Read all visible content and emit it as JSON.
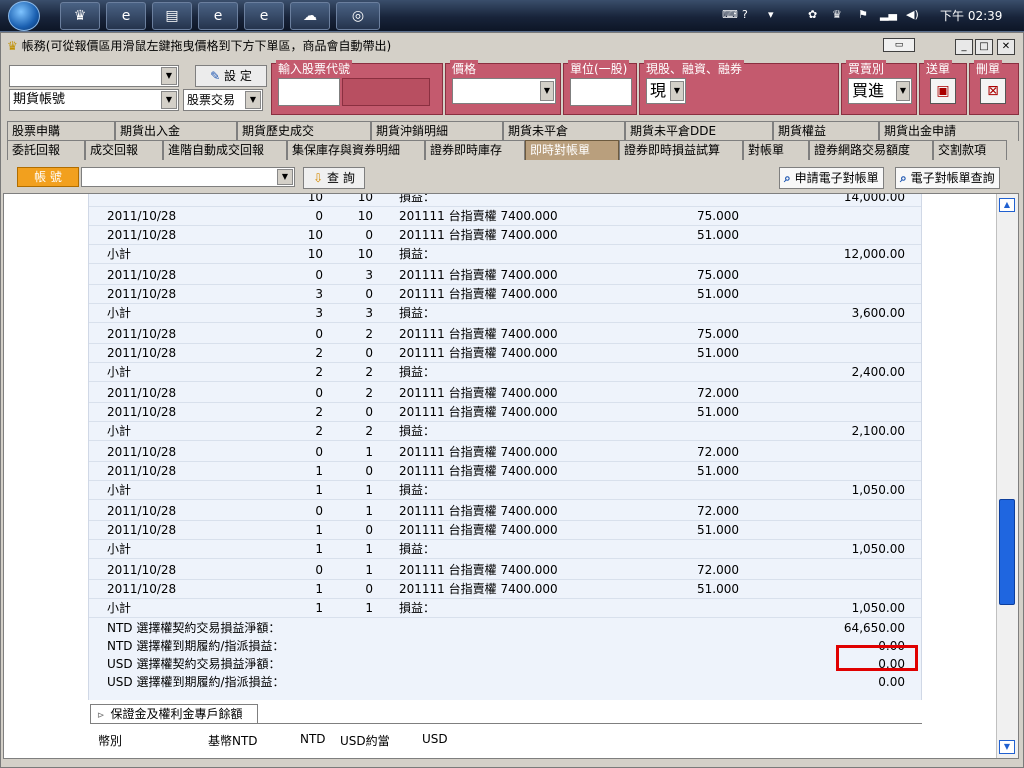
{
  "taskbar": {
    "clock": "下午 02:39"
  },
  "window": {
    "title": "帳務(可從報價區用滑鼠左鍵拖曳價格到下方下單區，商品會自動帶出)",
    "pin_label": "▭"
  },
  "order": {
    "account_value": "",
    "account_type": "期貨帳號",
    "set_label": "設 定",
    "trade_type": "股票交易",
    "groups": {
      "stock_code": "輸入股票代號",
      "price": "價格",
      "unit": "單位(一股)",
      "cash": "現股、融資、融券",
      "side": "買賣別",
      "send": "送單",
      "delete": "刪單"
    },
    "cash_value": "現",
    "side_value": "買進"
  },
  "tabs_row1": [
    "股票申購",
    "期貨出入金",
    "期貨歷史成交",
    "期貨沖銷明細",
    "期貨未平倉",
    "期貨未平倉DDE",
    "期貨權益",
    "期貨出金申請"
  ],
  "tabs_row2": [
    "委託回報",
    "成交回報",
    "進階自動成交回報",
    "集保庫存與資券明細",
    "證券即時庫存",
    "即時對帳單",
    "證券即時損益試算",
    "對帳單",
    "證券網路交易額度",
    "交割款項"
  ],
  "active_tab": "即時對帳單",
  "account_bar": {
    "label": "帳 號",
    "query_label": "查 詢",
    "apply_label": "申請電子對帳單",
    "lookup_label": "電子對帳單查詢"
  },
  "ledger": {
    "top_subtotal_q1": "10",
    "top_subtotal_q2": "10",
    "top_label": "損益：",
    "top_amount": "14,000.00",
    "groups": [
      {
        "buy": {
          "date": "2011/10/28",
          "q1": "0",
          "q2": "10",
          "product": "201111 台指賣權 7400.000",
          "price": "75.000"
        },
        "sell": {
          "date": "2011/10/28",
          "q1": "10",
          "q2": "0",
          "product": "201111 台指賣權 7400.000",
          "price": "51.000"
        },
        "subtotal": {
          "label": "小計",
          "q1": "10",
          "q2": "10",
          "pl": "損益：",
          "amount": "12,000.00"
        }
      },
      {
        "buy": {
          "date": "2011/10/28",
          "q1": "0",
          "q2": "3",
          "product": "201111 台指賣權 7400.000",
          "price": "75.000"
        },
        "sell": {
          "date": "2011/10/28",
          "q1": "3",
          "q2": "0",
          "product": "201111 台指賣權 7400.000",
          "price": "51.000"
        },
        "subtotal": {
          "label": "小計",
          "q1": "3",
          "q2": "3",
          "pl": "損益：",
          "amount": "3,600.00"
        }
      },
      {
        "buy": {
          "date": "2011/10/28",
          "q1": "0",
          "q2": "2",
          "product": "201111 台指賣權 7400.000",
          "price": "75.000"
        },
        "sell": {
          "date": "2011/10/28",
          "q1": "2",
          "q2": "0",
          "product": "201111 台指賣權 7400.000",
          "price": "51.000"
        },
        "subtotal": {
          "label": "小計",
          "q1": "2",
          "q2": "2",
          "pl": "損益：",
          "amount": "2,400.00"
        }
      },
      {
        "buy": {
          "date": "2011/10/28",
          "q1": "0",
          "q2": "2",
          "product": "201111 台指賣權 7400.000",
          "price": "72.000"
        },
        "sell": {
          "date": "2011/10/28",
          "q1": "2",
          "q2": "0",
          "product": "201111 台指賣權 7400.000",
          "price": "51.000"
        },
        "subtotal": {
          "label": "小計",
          "q1": "2",
          "q2": "2",
          "pl": "損益：",
          "amount": "2,100.00"
        }
      },
      {
        "buy": {
          "date": "2011/10/28",
          "q1": "0",
          "q2": "1",
          "product": "201111 台指賣權 7400.000",
          "price": "72.000"
        },
        "sell": {
          "date": "2011/10/28",
          "q1": "1",
          "q2": "0",
          "product": "201111 台指賣權 7400.000",
          "price": "51.000"
        },
        "subtotal": {
          "label": "小計",
          "q1": "1",
          "q2": "1",
          "pl": "損益：",
          "amount": "1,050.00"
        }
      },
      {
        "buy": {
          "date": "2011/10/28",
          "q1": "0",
          "q2": "1",
          "product": "201111 台指賣權 7400.000",
          "price": "72.000"
        },
        "sell": {
          "date": "2011/10/28",
          "q1": "1",
          "q2": "0",
          "product": "201111 台指賣權 7400.000",
          "price": "51.000"
        },
        "subtotal": {
          "label": "小計",
          "q1": "1",
          "q2": "1",
          "pl": "損益：",
          "amount": "1,050.00"
        }
      },
      {
        "buy": {
          "date": "2011/10/28",
          "q1": "0",
          "q2": "1",
          "product": "201111 台指賣權 7400.000",
          "price": "72.000"
        },
        "sell": {
          "date": "2011/10/28",
          "q1": "1",
          "q2": "0",
          "product": "201111 台指賣權 7400.000",
          "price": "51.000"
        },
        "subtotal": {
          "label": "小計",
          "q1": "1",
          "q2": "1",
          "pl": "損益：",
          "amount": "1,050.00"
        }
      }
    ],
    "totals": [
      {
        "label": "NTD 選擇權契約交易損益淨額：",
        "amount": "64,650.00"
      },
      {
        "label": "NTD 選擇權到期履約/指派損益：",
        "amount": "0.00"
      },
      {
        "label": "USD 選擇權契約交易損益淨額：",
        "amount": "0.00"
      },
      {
        "label": "USD 選擇權到期履約/指派損益：",
        "amount": "0.00"
      }
    ]
  },
  "margin": {
    "tab_label": "保證金及權利金專戶餘額",
    "headers": [
      "幣別",
      "基幣NTD",
      "NTD",
      "USD約當",
      "USD"
    ]
  }
}
